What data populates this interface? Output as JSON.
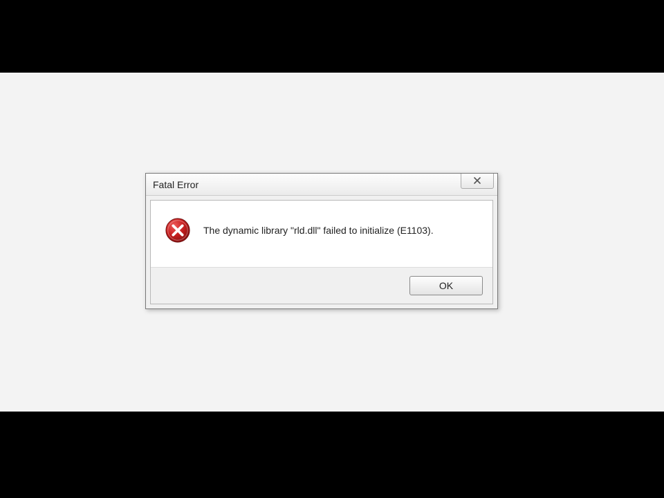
{
  "dialog": {
    "title": "Fatal Error",
    "message": "The dynamic library \"rld.dll\" failed to initialize (E1103).",
    "ok_label": "OK",
    "icon": "error-icon",
    "close_icon": "close-icon"
  },
  "colors": {
    "error_red": "#c41e1e",
    "error_red_dark": "#8f1414"
  }
}
